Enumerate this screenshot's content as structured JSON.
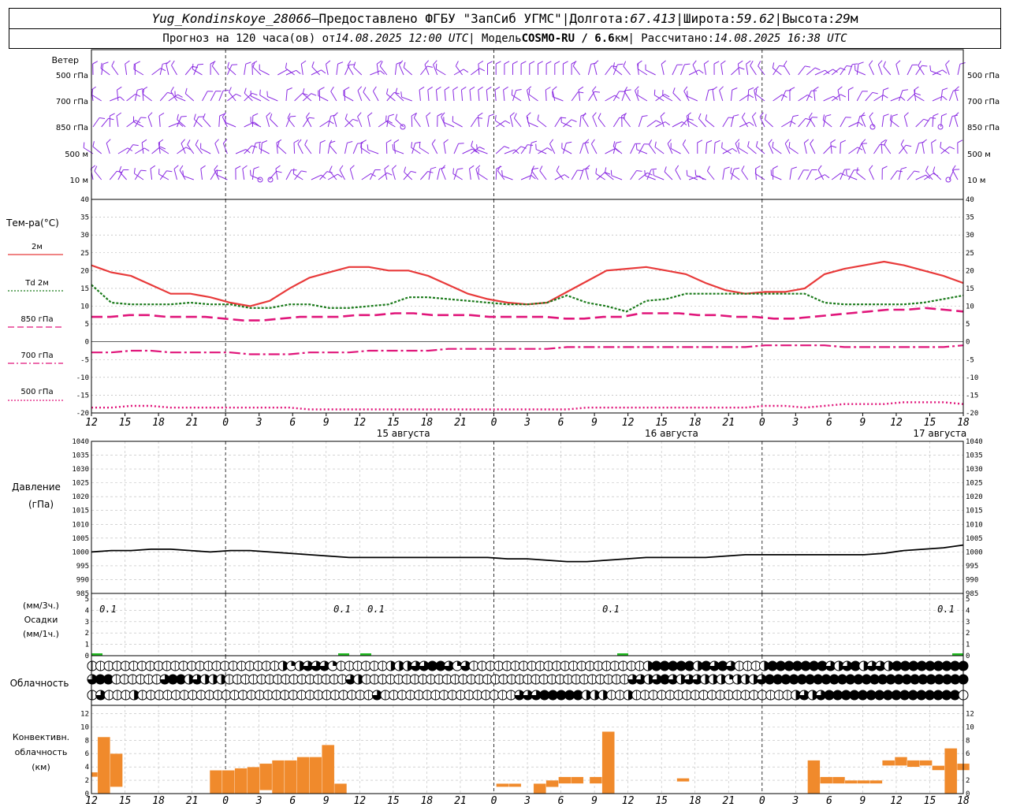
{
  "header": {
    "station": "Yug_Kondinskoye_28066",
    "dash": " – ",
    "provider": "Предоставлено ФГБУ \"ЗапСиб УГМС\"",
    "sep": " | ",
    "lon_label": "Долгота: ",
    "lon_value": "67.413",
    "lat_label": "Широта: ",
    "lat_value": "59.62",
    "alt_label": "Высота: ",
    "alt_value": "29",
    "alt_unit": "м",
    "forecast_label": "Прогноз на 120 часа(ов) от ",
    "forecast_time": "14.08.2025 12:00 UTC",
    "model_label": "  | Модель ",
    "model_name": "COSMO-RU / 6.6",
    "model_unit": "км",
    "computed_label": " | Рассчитано: ",
    "computed_time": "14.08.2025 16:38 UTC"
  },
  "colors": {
    "wind": "#8a2be2",
    "t2m": "#e83a3a",
    "td": "#1a7a1a",
    "t850_700_500": "#e0157a",
    "pressure": "#000000",
    "precip": "#22bb22",
    "conv": "#f08a2c",
    "grid": "#888888"
  },
  "wind_panel": {
    "title": "Ветер",
    "levels": [
      "500 гПа",
      "700 гПа",
      "850 гПа",
      "500 м",
      "10  м"
    ]
  },
  "temp_legend": {
    "title": "Тем-ра(°C)",
    "items": [
      {
        "label": "2м"
      },
      {
        "label": "Td  2м"
      },
      {
        "label": "850 гПа"
      },
      {
        "label": "700 гПа"
      },
      {
        "label": "500 гПа"
      }
    ]
  },
  "x_axis": {
    "hour_ticks": [
      "12",
      "15",
      "18",
      "21",
      "0",
      "3",
      "6",
      "9",
      "12",
      "15",
      "18",
      "21",
      "0",
      "3",
      "6",
      "9",
      "12",
      "15",
      "18",
      "21",
      "0",
      "3",
      "6",
      "9",
      "12",
      "15",
      "18"
    ],
    "dates": [
      "15 августа",
      "16 августа",
      "17 августа"
    ]
  },
  "pressure_panel": {
    "label1": "Давление",
    "label2": "(гПа)"
  },
  "precip_panel": {
    "label1": "(мм/3ч.)",
    "label2": "Осадки",
    "label3": "(мм/1ч.)",
    "annotations": [
      "0.1",
      "0.1",
      "0.1",
      "0.1",
      "0.1"
    ]
  },
  "cloud_panel": {
    "label": "Облачность"
  },
  "conv_panel": {
    "label1": "Конвективн.",
    "label2": "облачность",
    "label3": "(км)"
  },
  "chart_data": [
    {
      "type": "line",
      "title": "Тем-ра(°C)",
      "x_hours": [
        0,
        3,
        6,
        9,
        12,
        15,
        18,
        21,
        24,
        27,
        30,
        33,
        36,
        39,
        42,
        45,
        48,
        51,
        54,
        57,
        60,
        63,
        66,
        69,
        72,
        75,
        78,
        81,
        84,
        87,
        90,
        93,
        96,
        99,
        102,
        105,
        108,
        111,
        114,
        117,
        120,
        123,
        126
      ],
      "ylim": [
        -20,
        40
      ],
      "yticks": [
        40,
        35,
        30,
        25,
        20,
        15,
        10,
        5,
        0,
        -5,
        -10,
        -15,
        -20
      ],
      "series": [
        {
          "name": "2м",
          "values": [
            21.5,
            19.5,
            18.5,
            16,
            13.5,
            13.5,
            12.5,
            11,
            10,
            11.5,
            15,
            18,
            19.5,
            21,
            21,
            20,
            20,
            18.5,
            16,
            13.5,
            12,
            11,
            10.5,
            11,
            14,
            17,
            20,
            20.5,
            21,
            20,
            19,
            16.5,
            14.5,
            13.5,
            14,
            14,
            15,
            19,
            20.5,
            21.5,
            22.5,
            21.5,
            20,
            18.5,
            16.5
          ]
        },
        {
          "name": "Td  2м",
          "values": [
            16,
            11,
            10.5,
            10.5,
            10.5,
            11,
            10.5,
            10.5,
            9.5,
            9.5,
            10.5,
            10.5,
            9.5,
            9.5,
            10,
            10.5,
            12.5,
            12.5,
            12,
            11.5,
            11,
            10.5,
            10.5,
            11,
            13,
            11,
            10,
            8.5,
            11.5,
            12,
            13.5,
            13.5,
            13.5,
            13.5,
            13.5,
            13.5,
            13.5,
            11,
            10.5,
            10.5,
            10.5,
            10.5,
            11,
            12,
            13
          ]
        },
        {
          "name": "850 гПа",
          "values": [
            7,
            7,
            7.5,
            7.5,
            7,
            7,
            7,
            6.5,
            6,
            6,
            6.5,
            7,
            7,
            7,
            7.5,
            7.5,
            8,
            8,
            7.5,
            7.5,
            7.5,
            7,
            7,
            7,
            7,
            6.5,
            6.5,
            7,
            7,
            8,
            8,
            8,
            7.5,
            7.5,
            7,
            7,
            6.5,
            6.5,
            7,
            7.5,
            8,
            8.5,
            9,
            9,
            9.5,
            9,
            8.5
          ]
        },
        {
          "name": "700 гПа",
          "values": [
            -3,
            -3,
            -2.5,
            -2.5,
            -3,
            -3,
            -3,
            -3,
            -3.5,
            -3.5,
            -3.5,
            -3,
            -3,
            -3,
            -2.5,
            -2.5,
            -2.5,
            -2.5,
            -2,
            -2,
            -2,
            -2,
            -2,
            -2,
            -1.5,
            -1.5,
            -1.5,
            -1.5,
            -1.5,
            -1.5,
            -1.5,
            -1.5,
            -1.5,
            -1.5,
            -1,
            -1,
            -1,
            -1,
            -1.5,
            -1.5,
            -1.5,
            -1.5,
            -1.5,
            -1.5,
            -1
          ]
        },
        {
          "name": "500 гПа",
          "values": [
            -18.5,
            -18.5,
            -18,
            -18,
            -18.5,
            -18.5,
            -18.5,
            -18.5,
            -18.5,
            -18.5,
            -18.5,
            -19,
            -19,
            -19,
            -19,
            -19,
            -19,
            -19,
            -19,
            -19,
            -19,
            -19,
            -19,
            -19,
            -19,
            -18.5,
            -18.5,
            -18.5,
            -18.5,
            -18.5,
            -18.5,
            -18.5,
            -18.5,
            -18.5,
            -18,
            -18,
            -18.5,
            -18,
            -17.5,
            -17.5,
            -17.5,
            -17,
            -17,
            -17,
            -17.5
          ]
        }
      ]
    },
    {
      "type": "line",
      "title": "Давление (гПа)",
      "ylim": [
        985,
        1040
      ],
      "yticks": [
        1040,
        1035,
        1030,
        1025,
        1020,
        1015,
        1010,
        1005,
        1000,
        995,
        990,
        985
      ],
      "series": [
        {
          "name": "",
          "values": [
            1000,
            1000.5,
            1000.5,
            1001,
            1001,
            1000.5,
            1000,
            1000.5,
            1000.5,
            1000,
            999.5,
            999,
            998.5,
            998,
            998,
            998,
            998,
            998,
            998,
            998,
            998,
            997.5,
            997.5,
            997,
            996.5,
            996.5,
            997,
            997.5,
            998,
            998,
            998,
            998,
            998.5,
            999,
            999,
            999,
            999,
            999,
            999,
            999,
            999.5,
            1000.5,
            1001,
            1001.5,
            1002.5
          ]
        }
      ]
    },
    {
      "type": "bar",
      "title": "Осадки (мм/3ч.)",
      "ylim": [
        0,
        5
      ],
      "yticks": [
        5,
        4,
        3,
        2,
        1,
        0
      ],
      "bars": [
        {
          "x_hour": 1,
          "value": 0.1
        },
        {
          "x_hour": 45,
          "value": 0.1
        },
        {
          "x_hour": 49,
          "value": 0.1
        },
        {
          "x_hour": 95,
          "value": 0.1
        },
        {
          "x_hour": 124,
          "value": 0.1
        }
      ]
    },
    {
      "type": "table",
      "title": "Облачность",
      "legend": "fraction of circle filled = cloud cover fraction",
      "rows": [
        [
          0,
          0,
          0,
          0,
          0,
          0,
          0,
          0,
          0,
          0,
          0,
          0,
          0,
          0,
          0,
          0,
          0,
          0,
          0,
          0,
          0,
          0,
          0,
          0.5,
          0.25,
          0.5,
          0.75,
          0.75,
          0.75,
          0.25,
          0,
          0,
          0,
          0,
          0,
          0,
          0.5,
          0.5,
          0.5,
          0.75,
          0.75,
          1,
          1,
          0.75,
          0.25,
          0.75,
          0,
          0,
          0,
          0,
          0,
          0,
          0,
          0,
          0,
          0,
          0,
          0,
          0,
          0,
          0,
          0,
          0,
          0,
          0,
          0,
          0,
          0.5,
          1,
          1,
          1,
          1,
          1,
          0.5,
          1,
          0.75,
          1,
          0.75,
          0,
          0,
          0,
          0.5,
          1,
          1,
          1,
          1,
          1,
          1,
          1,
          0.75,
          0.5,
          0.75,
          1,
          0.5,
          0.75,
          0.75,
          0.5,
          1,
          1,
          1,
          1,
          1,
          1,
          1,
          1,
          1
        ],
        [
          0.75,
          1,
          1,
          0,
          0,
          0,
          0,
          0,
          0,
          0.75,
          1,
          1,
          0.5,
          0.75,
          0.5,
          0.5,
          0.5,
          0,
          0,
          0,
          0,
          0,
          0,
          0,
          0,
          0,
          0,
          0,
          0,
          0,
          0,
          0,
          0.75,
          0.5,
          0,
          0,
          0,
          0,
          0,
          0,
          0,
          0,
          0,
          0,
          0,
          0,
          0,
          0,
          0,
          0,
          0,
          0,
          0,
          0,
          0,
          0,
          0,
          0,
          0,
          0,
          0,
          0,
          0,
          0,
          0,
          0,
          0,
          0.75,
          0.75,
          0.5,
          0.75,
          1,
          0.75,
          0.5,
          0.75,
          0.75,
          0.5,
          0.5,
          0.5,
          0.25,
          0.5,
          0.5,
          0.5,
          0.75,
          1,
          1,
          1,
          1,
          1,
          1,
          1,
          1,
          1,
          1,
          1,
          1,
          1,
          1,
          1,
          1,
          1,
          1,
          1,
          1,
          1,
          1,
          1,
          1,
          1
        ],
        [
          0,
          0.75,
          0,
          0,
          0,
          0.5,
          0,
          0,
          0,
          0,
          0,
          0,
          0,
          0,
          0,
          0,
          0,
          0,
          0,
          0,
          0,
          0,
          0,
          0,
          0,
          0,
          0,
          0,
          0,
          0,
          0,
          0,
          0,
          0,
          0.75,
          0,
          0,
          0,
          0,
          0,
          0,
          0,
          0,
          0,
          0,
          0,
          0,
          0,
          0,
          0,
          0,
          0.75,
          0.75,
          0.75,
          1,
          1,
          1,
          1,
          1,
          0.5,
          0.5,
          0.5,
          0,
          0,
          0.5,
          0,
          0,
          0,
          0,
          0,
          0,
          0,
          0,
          0,
          0,
          0,
          0,
          0,
          0,
          0,
          0,
          0,
          0,
          0,
          0.5,
          0.75,
          0.5,
          0.75,
          1,
          1,
          1,
          1,
          1,
          1,
          1,
          1,
          1,
          1,
          1,
          1,
          1,
          1,
          1,
          1,
          0
        ]
      ]
    },
    {
      "type": "bar",
      "title": "Конвективн. облачность (км)",
      "ylim": [
        0,
        13
      ],
      "yticks": [
        12,
        10,
        8,
        6,
        4,
        2,
        0
      ],
      "bars": [
        {
          "x_hour": 0,
          "bottom": 2.5,
          "top": 3.2
        },
        {
          "x_hour": 3,
          "bottom": 0,
          "top": 8.5
        },
        {
          "x_hour": 9,
          "bottom": 1,
          "top": 6
        },
        {
          "x_hour": 57,
          "bottom": 0,
          "top": 3.5
        },
        {
          "x_hour": 63,
          "bottom": 0,
          "top": 3.5
        },
        {
          "x_hour": 69,
          "bottom": 0,
          "top": 3.8
        },
        {
          "x_hour": 75,
          "bottom": 0,
          "top": 4
        },
        {
          "x_hour": 81,
          "bottom": 0.5,
          "top": 4.5
        },
        {
          "x_hour": 87,
          "bottom": 0,
          "top": 5
        },
        {
          "x_hour": 93,
          "bottom": 0,
          "top": 5
        },
        {
          "x_hour": 99,
          "bottom": 0,
          "top": 5.5
        },
        {
          "x_hour": 105,
          "bottom": 0,
          "top": 5.5
        },
        {
          "x_hour": 111,
          "bottom": 0,
          "top": 7.3
        },
        {
          "x_hour": 117,
          "bottom": 0,
          "top": 1.5
        },
        {
          "x_hour": 195,
          "bottom": 1,
          "top": 1.5
        },
        {
          "x_hour": 201,
          "bottom": 1,
          "top": 1.5
        },
        {
          "x_hour": 213,
          "bottom": 0,
          "top": 1.5
        },
        {
          "x_hour": 219,
          "bottom": 1,
          "top": 2
        },
        {
          "x_hour": 225,
          "bottom": 1.5,
          "top": 2.5
        },
        {
          "x_hour": 231,
          "bottom": 1.5,
          "top": 2.5
        },
        {
          "x_hour": 240,
          "bottom": 1.5,
          "top": 2.5
        },
        {
          "x_hour": 246,
          "bottom": 0,
          "top": 9.3
        },
        {
          "x_hour": 282,
          "bottom": 1.8,
          "top": 2.3
        },
        {
          "x_hour": 345,
          "bottom": 0,
          "top": 5
        },
        {
          "x_hour": 351,
          "bottom": 1.5,
          "top": 2.5
        },
        {
          "x_hour": 357,
          "bottom": 1.5,
          "top": 2.5
        },
        {
          "x_hour": 363,
          "bottom": 1.5,
          "top": 2
        },
        {
          "x_hour": 369,
          "bottom": 1.5,
          "top": 2
        },
        {
          "x_hour": 375,
          "bottom": 1.5,
          "top": 2
        },
        {
          "x_hour": 381,
          "bottom": 4.2,
          "top": 5
        },
        {
          "x_hour": 387,
          "bottom": 4.2,
          "top": 5.5
        },
        {
          "x_hour": 393,
          "bottom": 4,
          "top": 5
        },
        {
          "x_hour": 399,
          "bottom": 4.2,
          "top": 5
        },
        {
          "x_hour": 405,
          "bottom": 3.5,
          "top": 4.2
        },
        {
          "x_hour": 411,
          "bottom": 0,
          "top": 6.8
        },
        {
          "x_hour": 417,
          "bottom": 3.5,
          "top": 4.5
        }
      ]
    }
  ]
}
